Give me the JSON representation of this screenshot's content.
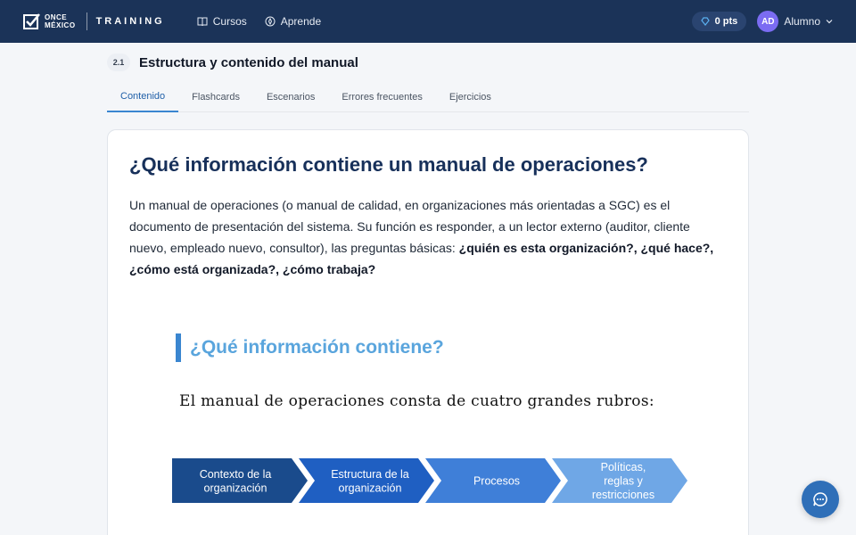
{
  "header": {
    "logo_line1": "ONCE",
    "logo_line2": "MÉXICO",
    "brand": "TRAINING",
    "nav": [
      {
        "label": "Cursos",
        "icon": "book-icon"
      },
      {
        "label": "Aprende",
        "icon": "compass-icon"
      }
    ],
    "points": "0 pts",
    "avatar": "AD",
    "user": "Alumno"
  },
  "section": {
    "number": "2.1",
    "title": "Estructura y contenido del manual",
    "tabs": [
      "Contenido",
      "Flashcards",
      "Escenarios",
      "Errores frecuentes",
      "Ejercicios"
    ],
    "active_tab": 0
  },
  "content": {
    "heading": "¿Qué información contiene un manual de operaciones?",
    "para_plain": "Un manual de operaciones (o manual de calidad, en organizaciones más orientadas a SGC) es el documento de presentación del sistema. Su función es responder, a un lector externo (auditor, cliente nuevo, empleado nuevo, consultor), las preguntas básicas: ",
    "para_bold": "¿quién es esta organización?, ¿qué hace?, ¿cómo está organizada?, ¿cómo trabaja?",
    "inner_title": "¿Qué información contiene?",
    "serif_line": "El manual de operaciones consta de cuatro grandes rubros:",
    "steps": [
      {
        "lines": [
          "Contexto de la",
          "organización"
        ],
        "color": "#1a4b8c"
      },
      {
        "lines": [
          "Estructura de la",
          "organización"
        ],
        "color": "#1f5fc2"
      },
      {
        "lines": [
          "Procesos"
        ],
        "color": "#3f7fd8"
      },
      {
        "lines": [
          "Políticas,",
          "reglas y",
          "restricciones"
        ],
        "color": "#6fa7e6"
      }
    ]
  },
  "chat": {
    "icon": "chat-icon"
  }
}
